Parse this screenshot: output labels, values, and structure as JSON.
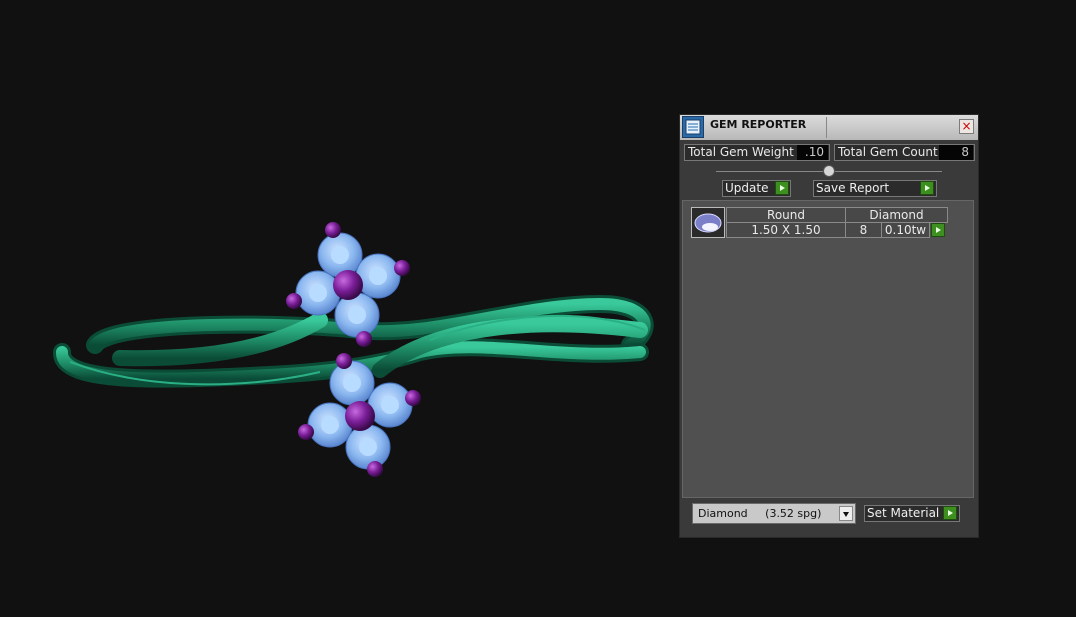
{
  "panel": {
    "title": "GEM REPORTER",
    "close_glyph": "×",
    "total_gem_weight_label": "Total Gem Weight",
    "total_gem_weight_value": ".10",
    "total_gem_count_label": "Total Gem Count",
    "total_gem_count_value": "8",
    "update_label": "Update",
    "save_report_label": "Save Report",
    "table": {
      "header": [
        "Round",
        "Diamond"
      ],
      "row": {
        "size": "1.50 X 1.50",
        "count": "8",
        "weight": "0.10tw"
      }
    },
    "material_select": {
      "value": "Diamond     (3.52 spg)"
    },
    "set_material_label": "Set Material"
  },
  "colors": {
    "ring": "#1f8f68",
    "gem": "#8cb8f0",
    "bead": "#6a1a8a",
    "accent_green": "#3d8f1f"
  },
  "icons": [
    "gem-reporter-icon",
    "close-icon",
    "play-arrow-icon",
    "gem-thumbnail-icon",
    "dropdown-arrow-icon"
  ]
}
